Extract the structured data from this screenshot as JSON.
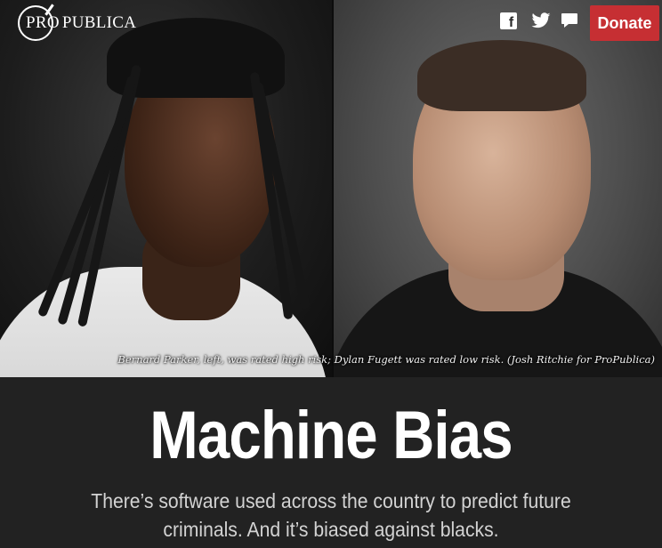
{
  "header": {
    "logo": {
      "text_pro": "Pro",
      "text_publica": "Publica"
    },
    "social": [
      {
        "name": "facebook-icon"
      },
      {
        "name": "twitter-icon"
      },
      {
        "name": "comment-icon"
      }
    ],
    "donate_label": "Donate"
  },
  "hero": {
    "caption": "Bernard Parker, left, was rated high risk; Dylan Fugett was rated low risk. (Josh Ritchie for ProPublica)"
  },
  "article": {
    "title": "Machine Bias",
    "dek": "There’s software used across the country to predict future criminals. And it’s biased against blacks."
  },
  "colors": {
    "background": "#222222",
    "donate": "#c62f33",
    "title": "#ffffff",
    "dek": "#d3d3d3"
  }
}
